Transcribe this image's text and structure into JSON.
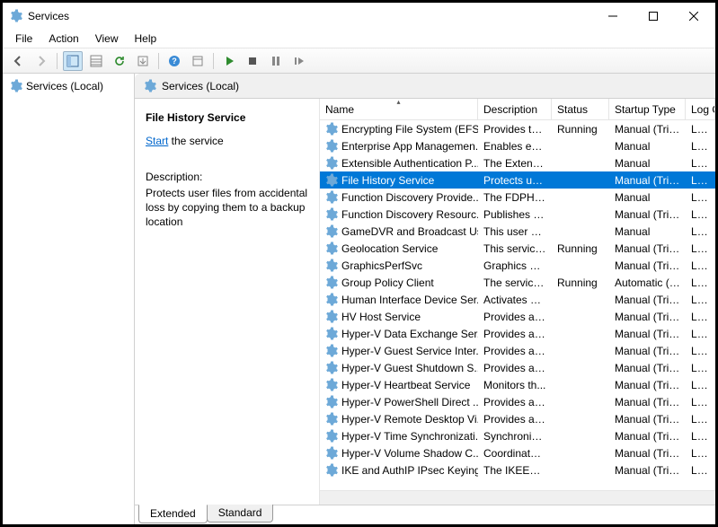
{
  "window": {
    "title": "Services"
  },
  "menu": {
    "file": "File",
    "action": "Action",
    "view": "View",
    "help": "Help"
  },
  "tree": {
    "root": "Services (Local)"
  },
  "header": {
    "title": "Services (Local)"
  },
  "detail": {
    "service_name": "File History Service",
    "start_link": "Start",
    "start_suffix": " the service",
    "desc_label": "Description:",
    "description": "Protects user files from accidental loss by copying them to a backup location"
  },
  "columns": {
    "name": "Name",
    "desc": "Description",
    "status": "Status",
    "startup": "Startup Type",
    "logon": "Log On As"
  },
  "tabs": {
    "extended": "Extended",
    "standard": "Standard"
  },
  "selected_index": 3,
  "services": [
    {
      "name": "Encrypting File System (EFS)",
      "desc": "Provides th...",
      "status": "Running",
      "startup": "Manual (Trig...",
      "logon": "Loca"
    },
    {
      "name": "Enterprise App Managemen...",
      "desc": "Enables ent...",
      "status": "",
      "startup": "Manual",
      "logon": "Loca"
    },
    {
      "name": "Extensible Authentication P...",
      "desc": "The Extensi...",
      "status": "",
      "startup": "Manual",
      "logon": "Loca"
    },
    {
      "name": "File History Service",
      "desc": "Protects use...",
      "status": "",
      "startup": "Manual (Trig...",
      "logon": "Loca"
    },
    {
      "name": "Function Discovery Provide...",
      "desc": "The FDPHO...",
      "status": "",
      "startup": "Manual",
      "logon": "Loca"
    },
    {
      "name": "Function Discovery Resourc...",
      "desc": "Publishes th...",
      "status": "",
      "startup": "Manual (Trig...",
      "logon": "Loca"
    },
    {
      "name": "GameDVR and Broadcast Us...",
      "desc": "This user ser...",
      "status": "",
      "startup": "Manual",
      "logon": "Loca"
    },
    {
      "name": "Geolocation Service",
      "desc": "This service ...",
      "status": "Running",
      "startup": "Manual (Trig...",
      "logon": "Loca"
    },
    {
      "name": "GraphicsPerfSvc",
      "desc": "Graphics pe...",
      "status": "",
      "startup": "Manual (Trig...",
      "logon": "Loca"
    },
    {
      "name": "Group Policy Client",
      "desc": "The service i...",
      "status": "Running",
      "startup": "Automatic (T...",
      "logon": "Loca"
    },
    {
      "name": "Human Interface Device Ser...",
      "desc": "Activates an...",
      "status": "",
      "startup": "Manual (Trig...",
      "logon": "Loca"
    },
    {
      "name": "HV Host Service",
      "desc": "Provides an ...",
      "status": "",
      "startup": "Manual (Trig...",
      "logon": "Loca"
    },
    {
      "name": "Hyper-V Data Exchange Ser...",
      "desc": "Provides a ...",
      "status": "",
      "startup": "Manual (Trig...",
      "logon": "Loca"
    },
    {
      "name": "Hyper-V Guest Service Inter...",
      "desc": "Provides an ...",
      "status": "",
      "startup": "Manual (Trig...",
      "logon": "Loca"
    },
    {
      "name": "Hyper-V Guest Shutdown S...",
      "desc": "Provides a ...",
      "status": "",
      "startup": "Manual (Trig...",
      "logon": "Loca"
    },
    {
      "name": "Hyper-V Heartbeat Service",
      "desc": "Monitors th...",
      "status": "",
      "startup": "Manual (Trig...",
      "logon": "Loca"
    },
    {
      "name": "Hyper-V PowerShell Direct ...",
      "desc": "Provides a ...",
      "status": "",
      "startup": "Manual (Trig...",
      "logon": "Loca"
    },
    {
      "name": "Hyper-V Remote Desktop Vi...",
      "desc": "Provides a p...",
      "status": "",
      "startup": "Manual (Trig...",
      "logon": "Loca"
    },
    {
      "name": "Hyper-V Time Synchronizati...",
      "desc": "Synchronize...",
      "status": "",
      "startup": "Manual (Trig...",
      "logon": "Loca"
    },
    {
      "name": "Hyper-V Volume Shadow C...",
      "desc": "Coordinates...",
      "status": "",
      "startup": "Manual (Trig...",
      "logon": "Loca"
    },
    {
      "name": "IKE and AuthIP IPsec Keying...",
      "desc": "The IKEEXT ...",
      "status": "",
      "startup": "Manual (Trig...",
      "logon": "Loca"
    }
  ]
}
